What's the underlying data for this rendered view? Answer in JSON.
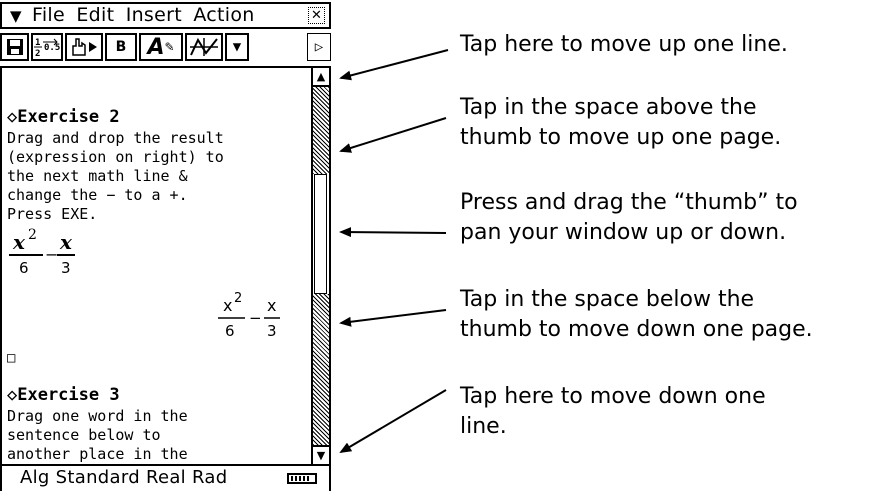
{
  "menubar": {
    "menu_icon": "chevron-down-icon",
    "items": [
      "File",
      "Edit",
      "Insert",
      "Action"
    ],
    "close_icon": "close-icon"
  },
  "toolbar": {
    "buttons": [
      "save-icon",
      "fraction-decimal-icon",
      "hand-execute-icon",
      "B",
      "A",
      "graph-icon",
      "dropdown-icon",
      "more-icon"
    ],
    "bold_label": "B",
    "font_label": "A"
  },
  "document": {
    "ex2_title": "◇Exercise 2",
    "ex2_lines": [
      "Drag and drop the result",
      "(expression on right) to",
      "the next math line &",
      "change the − to a +.",
      "Press EXE."
    ],
    "input_expr": {
      "num1": "x",
      "exp1": "2",
      "den1": "6",
      "op": "−",
      "num2": "x",
      "den2": "3"
    },
    "result_expr": {
      "num1": "x",
      "exp1": "2",
      "den1": "6",
      "op": "−",
      "num2": "x",
      "den2": "3"
    },
    "cursor": "□",
    "ex3_title": "◇Exercise 3",
    "ex3_lines": [
      "Drag one word in the",
      "sentence below to",
      "another place in the"
    ]
  },
  "statusbar": {
    "text": "Alg  Standard Real Rad",
    "battery_icon": "battery-icon"
  },
  "annotations": [
    "Tap here to move up one line.",
    "Tap in the space above the thumb to move up one page.",
    "Press and drag the “thumb” to pan your window up or down.",
    "Tap in the space below the thumb to move down one page.",
    "Tap here to move down one line."
  ],
  "annotation_lines": [
    [
      "Tap here to move up one line."
    ],
    [
      "Tap in the space above the",
      "thumb to move up one page."
    ],
    [
      "Press and drag the “thumb” to",
      "pan your window up or down."
    ],
    [
      "Tap in the space below the",
      "thumb to move down one page."
    ],
    [
      "Tap here to move down one",
      "line."
    ]
  ]
}
